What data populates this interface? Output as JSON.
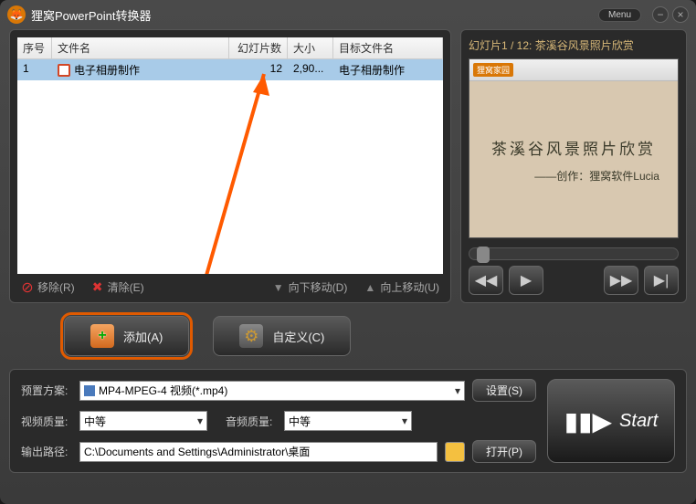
{
  "window": {
    "title": "狸窝PowerPoint转换器",
    "menu_label": "Menu"
  },
  "table": {
    "headers": {
      "num": "序号",
      "filename": "文件名",
      "slides": "幻灯片数",
      "size": "大小",
      "target": "目标文件名"
    },
    "row": {
      "num": "1",
      "filename": "电子相册制作",
      "slides": "12",
      "size": "2,90...",
      "target": "电子相册制作"
    }
  },
  "file_toolbar": {
    "remove": "移除(R)",
    "clear": "清除(E)",
    "move_down": "向下移动(D)",
    "move_up": "向上移动(U)"
  },
  "preview": {
    "header": "幻灯片1 / 12: 茶溪谷风景照片欣赏",
    "banner_brand": "狸窝家园",
    "main_text": "茶溪谷风景照片欣赏",
    "sub_text": "——创作：狸窝软件Lucia"
  },
  "mid": {
    "add": "添加(A)",
    "custom": "自定义(C)"
  },
  "settings": {
    "preset_label": "预置方案:",
    "preset_value": "MP4-MPEG-4 视频(*.mp4)",
    "set_btn": "设置(S)",
    "vq_label": "视频质量:",
    "vq_value": "中等",
    "aq_label": "音频质量:",
    "aq_value": "中等",
    "path_label": "输出路径:",
    "path_value": "C:\\Documents and Settings\\Administrator\\桌面",
    "open_btn": "打开(P)"
  },
  "start": {
    "label": "Start"
  }
}
